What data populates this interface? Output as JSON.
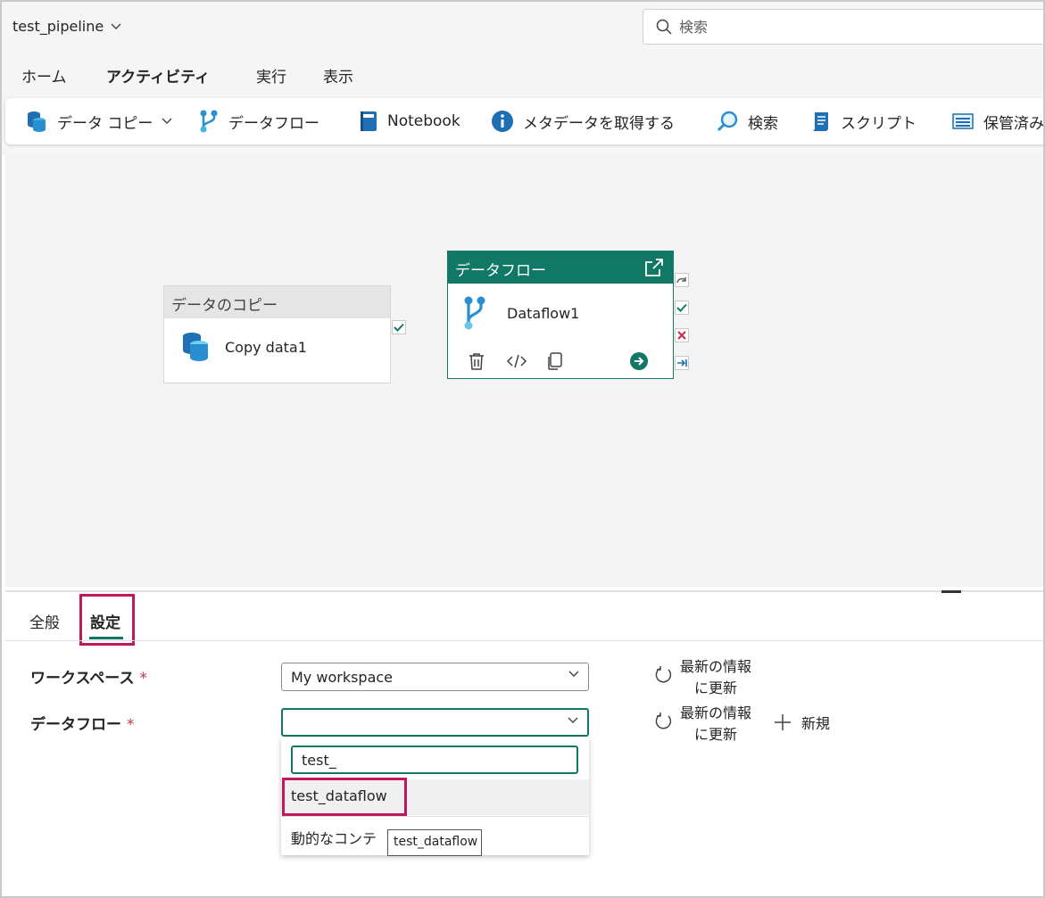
{
  "header": {
    "pipeline_name": "test_pipeline",
    "search_placeholder": "検索"
  },
  "menu": {
    "tabs": [
      {
        "label": "ホーム"
      },
      {
        "label": "アクティビティ",
        "active": true
      },
      {
        "label": "実行"
      },
      {
        "label": "表示"
      }
    ]
  },
  "ribbon": {
    "items": [
      {
        "label": "データ コピー",
        "icon": "database-icon",
        "has_dropdown": true
      },
      {
        "label": "データフロー",
        "icon": "dataflow-icon"
      },
      {
        "label": "Notebook",
        "icon": "notebook-icon"
      },
      {
        "label": "メタデータを取得する",
        "icon": "info-icon"
      },
      {
        "label": "検索",
        "icon": "lookup-icon"
      },
      {
        "label": "スクリプト",
        "icon": "script-icon"
      },
      {
        "label": "保管済み",
        "icon": "stored-procedure-icon"
      }
    ]
  },
  "canvas": {
    "copy_node": {
      "type_label": "データのコピー",
      "name": "Copy data1"
    },
    "dataflow_node": {
      "type_label": "データフロー",
      "name": "Dataflow1"
    }
  },
  "settings": {
    "tabs": [
      {
        "label": "全般"
      },
      {
        "label": "設定",
        "active": true
      }
    ],
    "workspace_label": "ワークスペース",
    "workspace_value": "My workspace",
    "dataflow_label": "データフロー",
    "dataflow_value": "",
    "required_mark": "*",
    "refresh_line1": "最新の情報",
    "refresh_line2": "に更新",
    "new_label": "新規",
    "dropdown": {
      "search_value": "test_",
      "options": [
        "test_dataflow",
        "動的なコンテ"
      ],
      "tooltip": "test_dataflow"
    }
  },
  "colors": {
    "accent": "#117865",
    "highlight": "#c0185f",
    "required": "#c4314b"
  }
}
